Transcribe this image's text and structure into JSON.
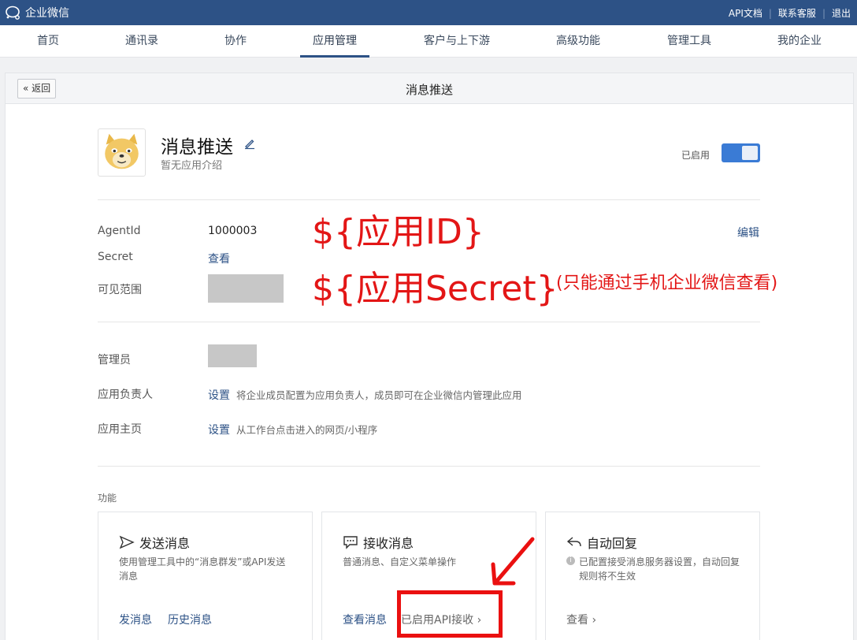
{
  "topbar": {
    "logo_text": "企业微信",
    "links": [
      "API文档",
      "联系客服",
      "退出"
    ]
  },
  "nav": {
    "items": [
      "首页",
      "通讯录",
      "协作",
      "应用管理",
      "客户与上下游",
      "高级功能",
      "管理工具",
      "我的企业"
    ],
    "active": "应用管理"
  },
  "panel": {
    "back_label": "« 返回",
    "title": "消息推送"
  },
  "app": {
    "name": "消息推送",
    "description": "暂无应用介绍",
    "status_label": "已启用",
    "enabled": true
  },
  "details": {
    "agentid_label": "AgentId",
    "agentid_value": "1000003",
    "edit_label": "编辑",
    "secret_label": "Secret",
    "secret_action": "查看",
    "visibility_label": "可见范围",
    "admin_label": "管理员",
    "owner_label": "应用负责人",
    "owner_action": "设置",
    "owner_hint": "将企业成员配置为应用负责人，成员即可在企业微信内管理此应用",
    "homepage_label": "应用主页",
    "homepage_action": "设置",
    "homepage_hint": "从工作台点击进入的网页/小程序"
  },
  "annotations": {
    "appid": "${应用ID}",
    "secret": "${应用Secret}",
    "secret_note": "(只能通过手机企业微信查看)"
  },
  "features": {
    "section_label": "功能",
    "cards": [
      {
        "title": "发送消息",
        "desc": "使用管理工具中的“消息群发”或API发送消息",
        "actions": [
          "发消息",
          "历史消息"
        ]
      },
      {
        "title": "接收消息",
        "desc": "普通消息、自定义菜单操作",
        "actions": [
          "查看消息",
          "已启用API接收 ›"
        ]
      },
      {
        "title": "自动回复",
        "desc": "已配置接受消息服务器设置，自动回复规则将不生效",
        "actions": [
          "查看 ›"
        ]
      }
    ]
  },
  "colors": {
    "topbar": "#2d5286",
    "accent": "#3a7bd5",
    "annotation": "#e31616"
  }
}
